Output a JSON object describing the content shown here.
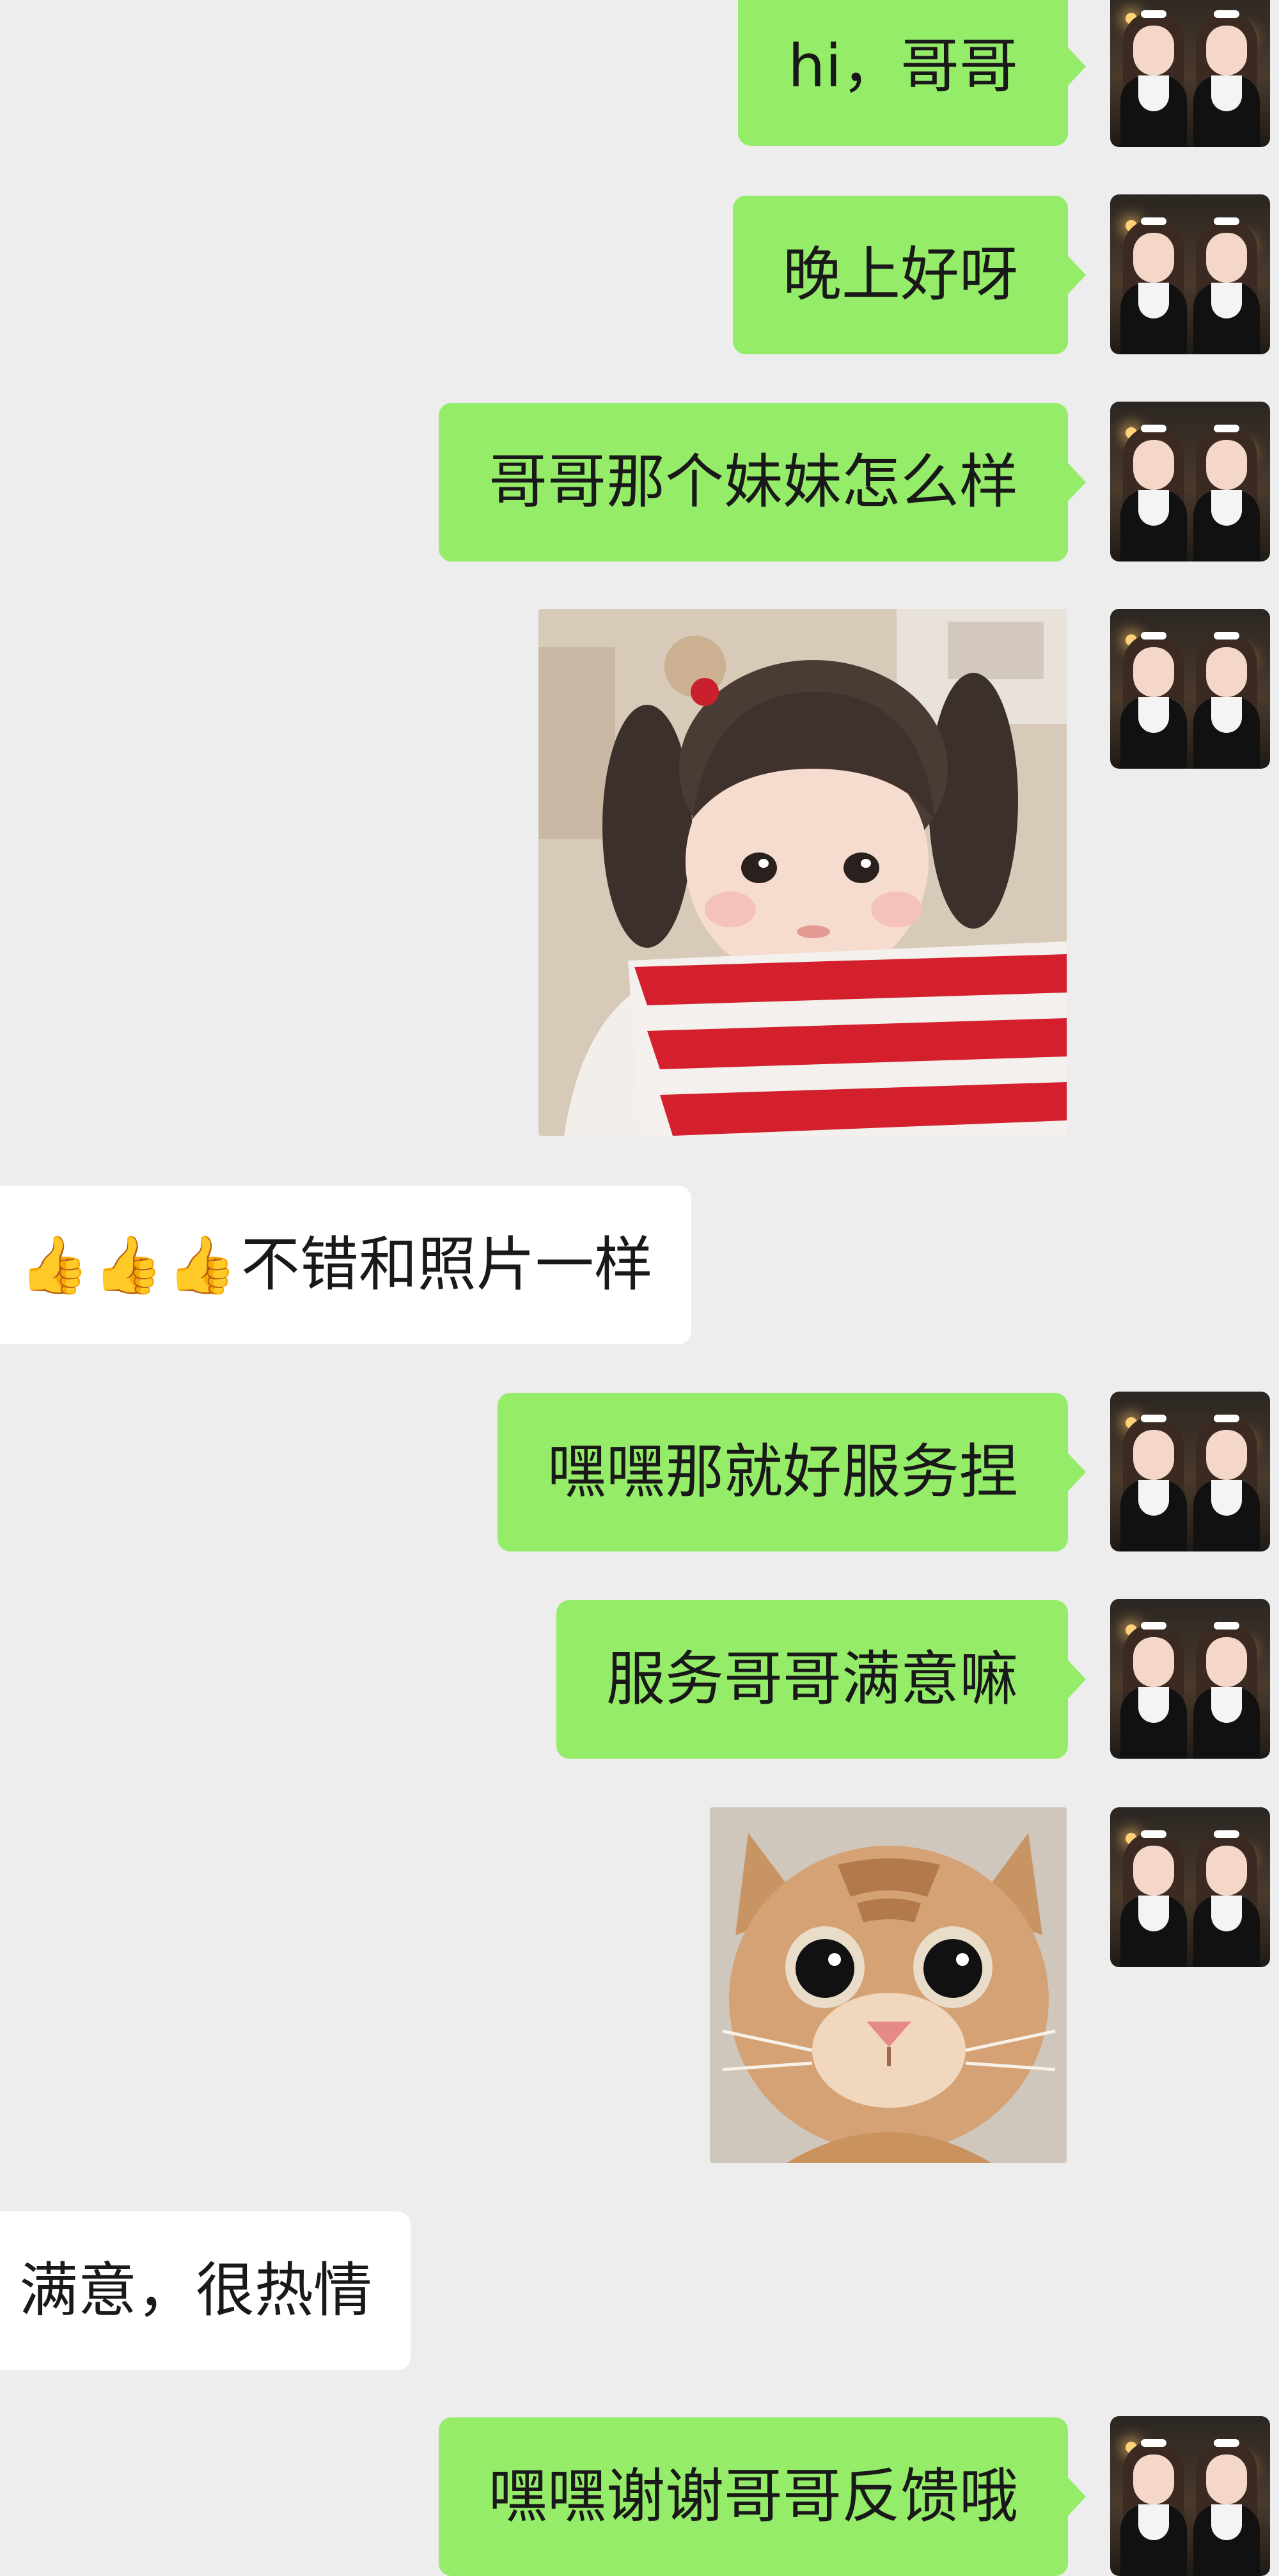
{
  "colors": {
    "background": "#ededed",
    "sent_bubble": "#95ec69",
    "received_bubble": "#ffffff",
    "text": "#191919"
  },
  "messages": [
    {
      "side": "sent",
      "type": "text",
      "text": "hi，哥哥"
    },
    {
      "side": "sent",
      "type": "text",
      "text": "晚上好呀"
    },
    {
      "side": "sent",
      "type": "text",
      "text": "哥哥那个妹妹怎么样"
    },
    {
      "side": "sent",
      "type": "image",
      "image": "photo-of-little-girl-with-pigtails-and-red-white-striped-scarf"
    },
    {
      "side": "received",
      "type": "text",
      "emoji": [
        "👍",
        "👍",
        "👍"
      ],
      "text": "不错和照片一样"
    },
    {
      "side": "sent",
      "type": "text",
      "text": "嘿嘿那就好服务捏"
    },
    {
      "side": "sent",
      "type": "text",
      "text": "服务哥哥满意嘛"
    },
    {
      "side": "sent",
      "type": "image",
      "image": "close-up-photo-of-orange-kitten"
    },
    {
      "side": "received",
      "type": "text",
      "text": "满意，很热情"
    },
    {
      "side": "sent",
      "type": "text",
      "text": "嘿嘿谢谢哥哥反馈哦"
    }
  ]
}
